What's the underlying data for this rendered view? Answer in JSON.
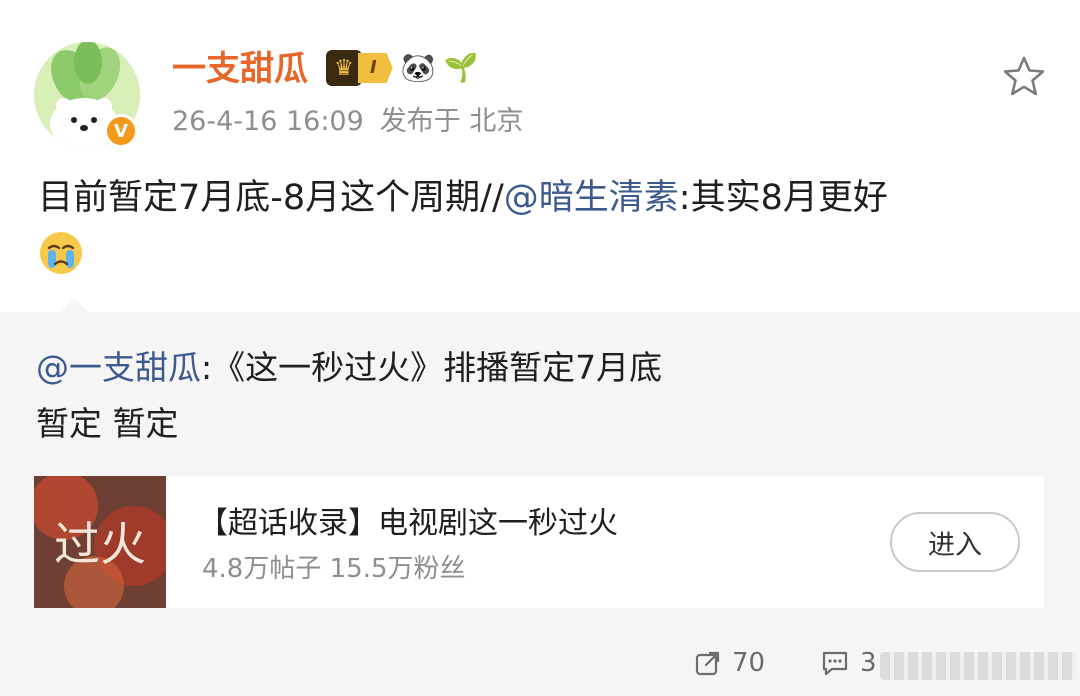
{
  "user": {
    "name": "一支甜瓜",
    "level_label": "I",
    "badge_emojis": [
      "🐼",
      "🌱"
    ],
    "verified_mark": "V"
  },
  "post": {
    "timestamp": "26-4-16 16:09",
    "location": "发布于 北京",
    "text_before": "目前暂定7月底-8月这个周期//",
    "mention": "@暗生清素",
    "text_after": ":其实8月更好"
  },
  "repost": {
    "mention": "@一支甜瓜",
    "line1": ":《这一秒过火》排播暂定7月底",
    "line2": "暂定 暂定"
  },
  "card": {
    "title": "【超话收录】电视剧这一秒过火",
    "stats": "4.8万帖子 15.5万粉丝",
    "thumb_text": "过火",
    "enter_label": "进入"
  },
  "footer": {
    "share_count": "70",
    "comment_count": "3"
  },
  "colors": {
    "username": "#e8662a",
    "mention": "#3d5a8f",
    "secondary_text": "#8e8e8e",
    "repost_bg": "#f5f5f5"
  }
}
